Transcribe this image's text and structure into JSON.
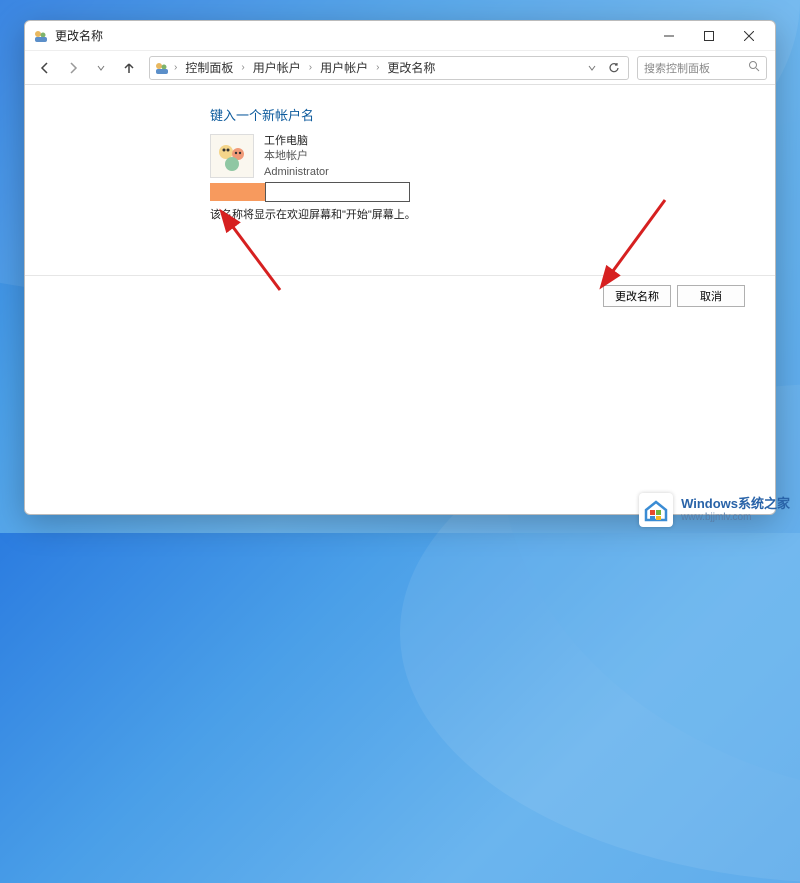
{
  "window": {
    "title": "更改名称"
  },
  "breadcrumb": {
    "items": [
      "控制面板",
      "用户帐户",
      "用户帐户",
      "更改名称"
    ]
  },
  "search": {
    "placeholder": "搜索控制面板"
  },
  "main": {
    "heading": "键入一个新帐户名",
    "account": {
      "name": "工作电脑",
      "type": "本地帐户",
      "role": "Administrator"
    },
    "input_value": "",
    "helper_text": "该名称将显示在欢迎屏幕和\"开始\"屏幕上。"
  },
  "buttons": {
    "confirm": "更改名称",
    "cancel": "取消"
  },
  "watermark": {
    "title": "Windows系统之家",
    "url": "www.bjjmlv.com"
  }
}
